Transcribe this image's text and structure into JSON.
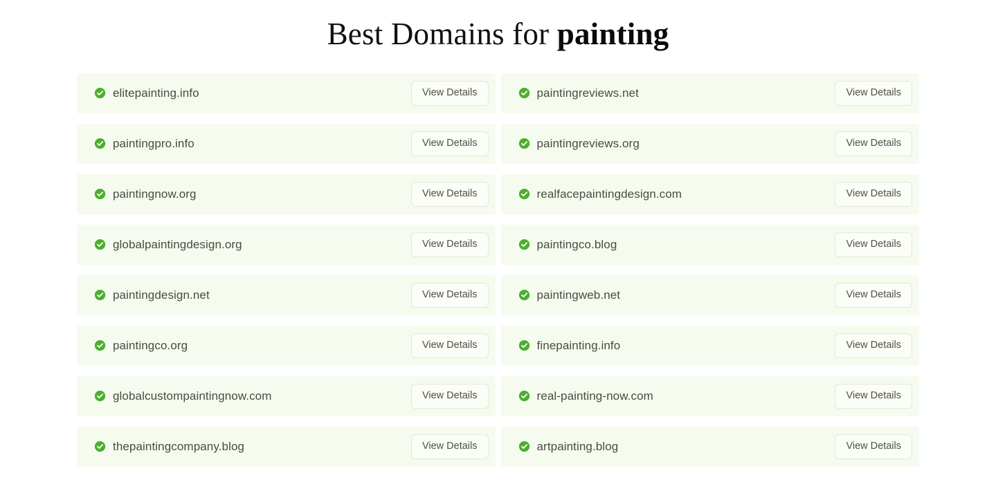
{
  "header": {
    "title_prefix": "Best Domains for ",
    "title_keyword": "painting"
  },
  "theme": {
    "page_background": "#ffffff",
    "card_background": "#f5fbee",
    "check_icon_color": "#4caf2f",
    "domain_text_color": "#4b4b45",
    "button_border_color": "#e2e8da",
    "button_text_color": "#4f4f4a",
    "title_color": "#111111"
  },
  "results": {
    "button_label": "View Details",
    "status_icon": "check-circle-icon",
    "columns": [
      {
        "name": "left-column",
        "items": [
          {
            "domain": "elitepainting.info"
          },
          {
            "domain": "paintingpro.info"
          },
          {
            "domain": "paintingnow.org"
          },
          {
            "domain": "globalpaintingdesign.org"
          },
          {
            "domain": "paintingdesign.net"
          },
          {
            "domain": "paintingco.org"
          },
          {
            "domain": "globalcustompaintingnow.com"
          },
          {
            "domain": "thepaintingcompany.blog"
          }
        ]
      },
      {
        "name": "right-column",
        "items": [
          {
            "domain": "paintingreviews.net"
          },
          {
            "domain": "paintingreviews.org"
          },
          {
            "domain": "realfacepaintingdesign.com"
          },
          {
            "domain": "paintingco.blog"
          },
          {
            "domain": "paintingweb.net"
          },
          {
            "domain": "finepainting.info"
          },
          {
            "domain": "real-painting-now.com"
          },
          {
            "domain": "artpainting.blog"
          }
        ]
      }
    ]
  }
}
